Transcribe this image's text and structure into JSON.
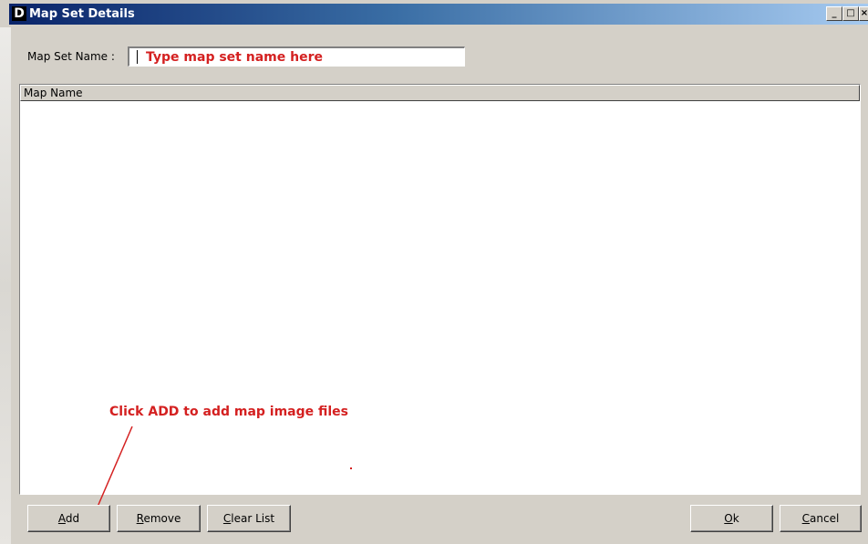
{
  "window": {
    "app_icon_glyph": "D",
    "title": "Map Set Details",
    "controls": {
      "minimize": "_",
      "maximize": "□",
      "close": "×"
    }
  },
  "form": {
    "map_set_name_label": "Map Set Name :",
    "map_set_name_hint": "Type map set name here"
  },
  "list": {
    "columns": [
      "Map Name"
    ],
    "rows": []
  },
  "annotation": {
    "text": "Click ADD to add map image files",
    "color": "#d42020"
  },
  "buttons": {
    "add": {
      "mnemonic": "A",
      "rest": "dd"
    },
    "remove": {
      "mnemonic": "R",
      "rest": "emove"
    },
    "clear_list": {
      "mnemonic": "C",
      "rest": "lear List"
    },
    "ok": {
      "mnemonic": "O",
      "rest": "k"
    },
    "cancel": {
      "mnemonic": "C",
      "rest": "ancel"
    }
  }
}
